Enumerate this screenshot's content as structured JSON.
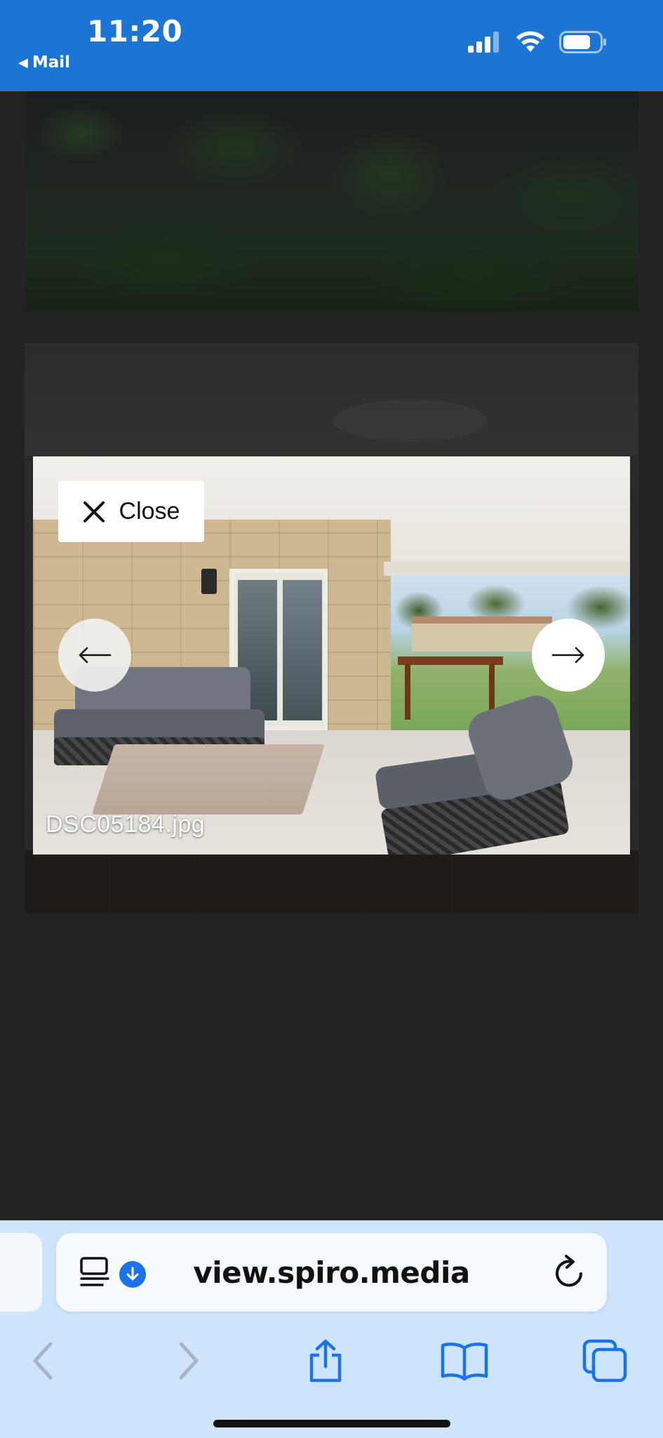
{
  "status_bar": {
    "time": "11:20",
    "back_app": "Mail",
    "icons": [
      "cellular-signal-icon",
      "wifi-icon",
      "battery-icon"
    ]
  },
  "lightbox": {
    "close_label": "Close",
    "prev_icon": "arrow-left-icon",
    "next_icon": "arrow-right-icon",
    "filename": "DSC05184.jpg"
  },
  "browser": {
    "url": "view.spiro.media",
    "icons": [
      "reader-mode-icon",
      "download-icon",
      "reload-icon"
    ],
    "toolbar": [
      "back-icon",
      "forward-icon",
      "share-icon",
      "bookmarks-icon",
      "tabs-icon"
    ]
  },
  "colors": {
    "status_bar_bg": "#1c74d4",
    "page_bg": "#232323",
    "safari_bar_bg": "#cde4fa",
    "accent": "#1a73e8"
  }
}
